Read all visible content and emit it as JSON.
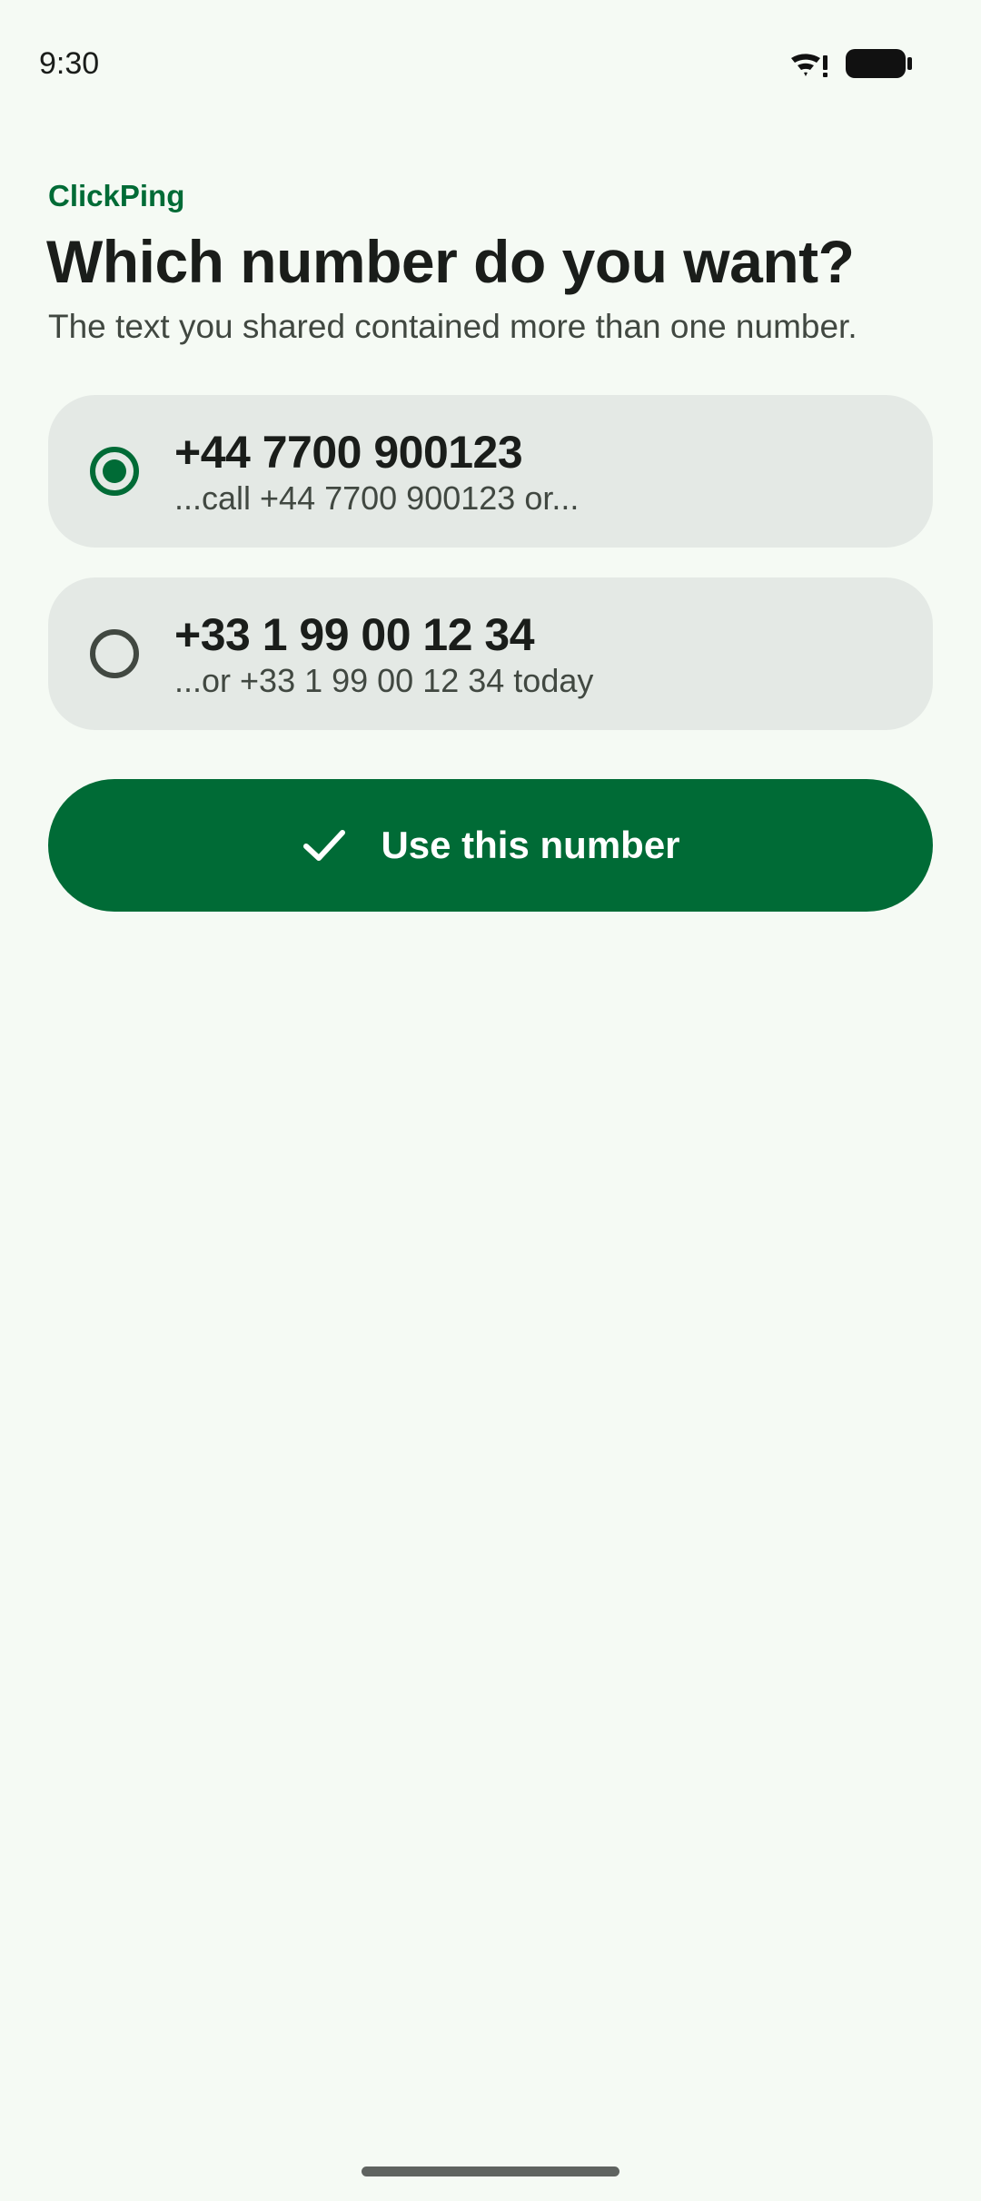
{
  "status_bar": {
    "time": "9:30",
    "icons": [
      "wifi-icon",
      "battery-icon"
    ]
  },
  "header": {
    "app_name": "ClickPing",
    "title": "Which number do you want?",
    "subtitle": "The text you shared contained more than one number."
  },
  "options": [
    {
      "number": "+44 7700 900123",
      "context": "...call +44 7700 900123 or...",
      "selected": true
    },
    {
      "number": "+33 1 99 00 12 34",
      "context": "...or +33 1 99 00 12 34 today",
      "selected": false
    }
  ],
  "action": {
    "label": "Use this number",
    "icon": "check-icon"
  },
  "colors": {
    "accent": "#006b36",
    "background": "#f5faf4",
    "card": "#e4e9e5",
    "text_primary": "#1a1d1a",
    "text_secondary": "#414841"
  }
}
